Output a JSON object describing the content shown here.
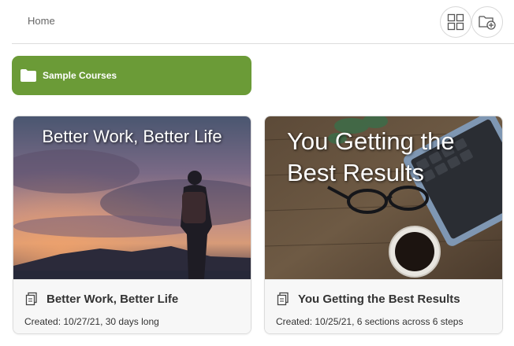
{
  "header": {
    "breadcrumb": "Home",
    "grid_view_icon": "grid-icon",
    "new_folder_icon": "folder-add-icon"
  },
  "folder": {
    "label": "Sample Courses",
    "icon": "folder-icon",
    "color": "#6b9b37"
  },
  "courses": [
    {
      "image_title": "Better Work, Better Life",
      "title": "Better Work, Better Life",
      "meta": "Created: 10/27/21, 30 days long",
      "icon": "course-pages-icon"
    },
    {
      "image_title": "You Getting the Best Results",
      "title": "You Getting the Best Results",
      "meta": "Created: 10/25/21, 6 sections across 6 steps",
      "icon": "course-pages-icon"
    }
  ]
}
